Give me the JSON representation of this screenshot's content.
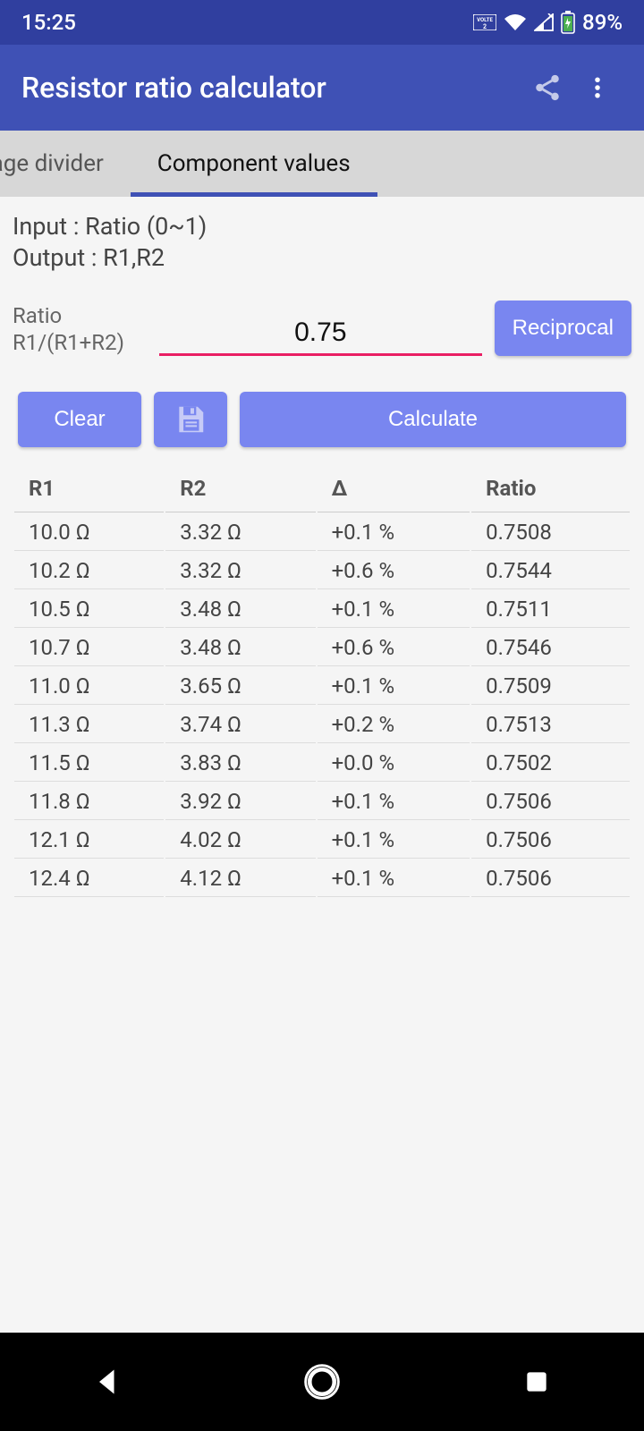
{
  "status": {
    "time": "15:25",
    "battery": "89%"
  },
  "app": {
    "title": "Resistor ratio calculator"
  },
  "tabs": {
    "inactive": "oltage divider",
    "active": "Component values"
  },
  "io": {
    "input": "Input : Ratio (0~1)",
    "output": "Output : R1,R2"
  },
  "ratio": {
    "label1": "Ratio",
    "label2": "R1/(R1+R2)",
    "value": "0.75"
  },
  "buttons": {
    "reciprocal": "Reciprocal",
    "clear": "Clear",
    "calculate": "Calculate"
  },
  "headers": {
    "r1": "R1",
    "r2": "R2",
    "delta": "Δ",
    "ratio": "Ratio"
  },
  "rows": [
    {
      "r1": "10.0 Ω",
      "r2": "3.32 Ω",
      "delta": "+0.1 %",
      "ratio": "0.7508"
    },
    {
      "r1": "10.2 Ω",
      "r2": "3.32 Ω",
      "delta": "+0.6 %",
      "ratio": "0.7544"
    },
    {
      "r1": "10.5 Ω",
      "r2": "3.48 Ω",
      "delta": "+0.1 %",
      "ratio": "0.7511"
    },
    {
      "r1": "10.7 Ω",
      "r2": "3.48 Ω",
      "delta": "+0.6 %",
      "ratio": "0.7546"
    },
    {
      "r1": "11.0 Ω",
      "r2": "3.65 Ω",
      "delta": "+0.1 %",
      "ratio": "0.7509"
    },
    {
      "r1": "11.3 Ω",
      "r2": "3.74 Ω",
      "delta": "+0.2 %",
      "ratio": "0.7513"
    },
    {
      "r1": "11.5 Ω",
      "r2": "3.83 Ω",
      "delta": "+0.0 %",
      "ratio": "0.7502"
    },
    {
      "r1": "11.8 Ω",
      "r2": "3.92 Ω",
      "delta": "+0.1 %",
      "ratio": "0.7506"
    },
    {
      "r1": "12.1 Ω",
      "r2": "4.02 Ω",
      "delta": "+0.1 %",
      "ratio": "0.7506"
    },
    {
      "r1": "12.4 Ω",
      "r2": "4.12 Ω",
      "delta": "+0.1 %",
      "ratio": "0.7506"
    }
  ]
}
